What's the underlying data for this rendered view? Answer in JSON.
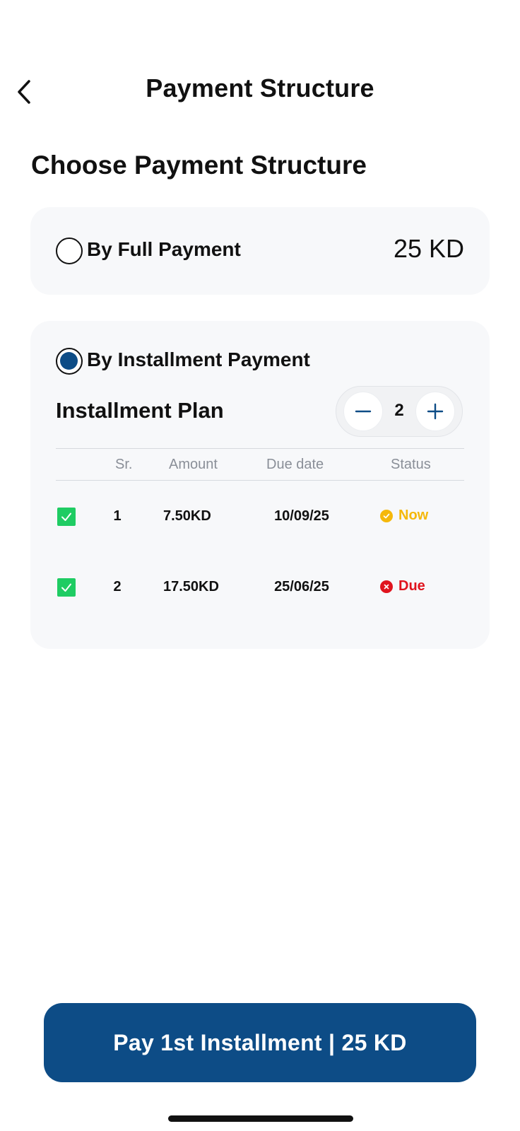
{
  "header": {
    "title": "Payment Structure",
    "back_icon": "chevron-left-icon"
  },
  "section_title": "Choose Payment Structure",
  "full_payment": {
    "label": "By Full Payment",
    "price": "25 KD",
    "selected": false
  },
  "installment_payment": {
    "label": "By Installment Payment",
    "selected": true,
    "plan_label": "Installment Plan",
    "stepper": {
      "value": "2",
      "minus_icon": "minus-icon",
      "plus_icon": "plus-icon"
    },
    "table": {
      "headers": {
        "sr": "Sr.",
        "amount": "Amount",
        "due": "Due date",
        "status": "Status"
      },
      "rows": [
        {
          "sr": "1",
          "amount": "7.50KD",
          "due": "10/09/25",
          "status": "Now",
          "status_color": "#f5b80a",
          "checked": true
        },
        {
          "sr": "2",
          "amount": "17.50KD",
          "due": "25/06/25",
          "status": "Due",
          "status_color": "#e0141e",
          "checked": true
        }
      ]
    }
  },
  "pay_button": {
    "label": "Pay 1st Installment | 25 KD"
  },
  "colors": {
    "primary": "#0d4c86",
    "check_green": "#1fcc63",
    "card_bg": "#f7f8fa"
  }
}
